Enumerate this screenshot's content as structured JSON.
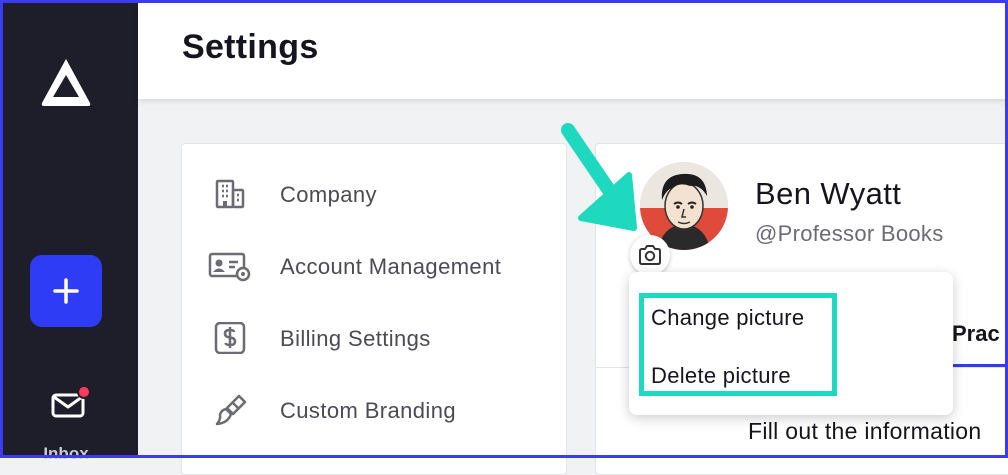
{
  "page": {
    "title": "Settings"
  },
  "nav": {
    "inbox_label": "Inbox",
    "has_unread": true
  },
  "settings_menu": [
    {
      "label": "Company",
      "icon": "building-icon"
    },
    {
      "label": "Account Management",
      "icon": "id-card-gear-icon"
    },
    {
      "label": "Billing Settings",
      "icon": "dollar-doc-icon"
    },
    {
      "label": "Custom Branding",
      "icon": "paintbrush-icon"
    }
  ],
  "profile": {
    "name": "Ben Wyatt",
    "handle": "@Professor Books",
    "active_tab_label": "Prac",
    "intro_text": "Fill out the information"
  },
  "picture_menu": {
    "change_label": "Change picture",
    "delete_label": "Delete picture"
  },
  "colors": {
    "rail": "#1e1e2a",
    "accent": "#2f3cf5",
    "highlight": "#1ed9bf",
    "notification": "#ff3a5c"
  }
}
